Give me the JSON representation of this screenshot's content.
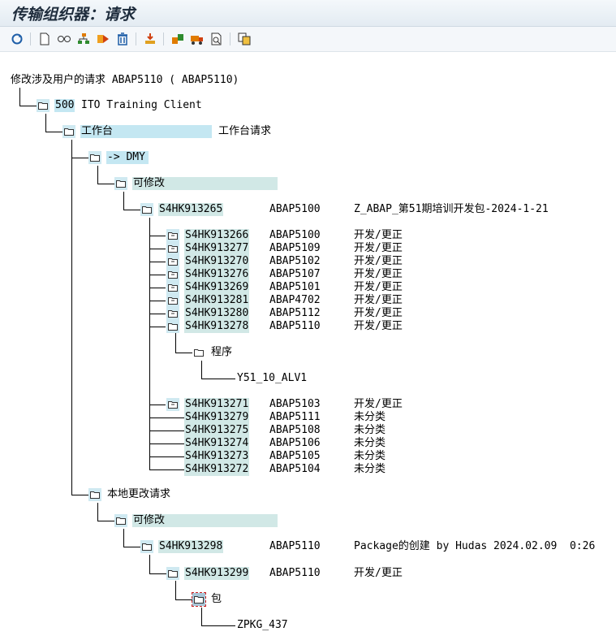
{
  "window": {
    "title": "传输组织器：请求"
  },
  "toolbar": {
    "icons": [
      "refresh-icon",
      "new-document-icon",
      "display-change-icon",
      "hierarchy-icon",
      "release-icon",
      "delete-icon",
      "import-icon",
      "object-list-icon",
      "transport-truck-icon",
      "search-icon",
      "copy-icon"
    ]
  },
  "colors": {
    "folder_highlight": "#cfe9f1",
    "band_highlight": "#d1e8e6",
    "selected_cyan": "#c4e7f2"
  },
  "tree": {
    "root": "修改涉及用户的请求 ABAP5110 ( ABAP5110)",
    "client_number": "500",
    "client_name": "ITO Training Client",
    "workbench": {
      "label": "工作台",
      "desc": "工作台请求"
    },
    "dmy": "-> DMY",
    "modifiable": "可修改",
    "main_request": {
      "id": "S4HK913265",
      "user": "ABAP5100",
      "desc": "Z_ABAP_第51期培训开发包-2024-1-21"
    },
    "tasks": [
      {
        "id": "S4HK913266",
        "user": "ABAP5100",
        "type": "开发/更正"
      },
      {
        "id": "S4HK913277",
        "user": "ABAP5109",
        "type": "开发/更正"
      },
      {
        "id": "S4HK913270",
        "user": "ABAP5102",
        "type": "开发/更正"
      },
      {
        "id": "S4HK913276",
        "user": "ABAP5107",
        "type": "开发/更正"
      },
      {
        "id": "S4HK913269",
        "user": "ABAP5101",
        "type": "开发/更正"
      },
      {
        "id": "S4HK913281",
        "user": "ABAP4702",
        "type": "开发/更正"
      },
      {
        "id": "S4HK913280",
        "user": "ABAP5112",
        "type": "开发/更正"
      },
      {
        "id": "S4HK913278",
        "user": "ABAP5110",
        "type": "开发/更正"
      }
    ],
    "program_folder": "程序",
    "program_object": "Y51_10_ALV1",
    "tasks2": [
      {
        "id": "S4HK913271",
        "user": "ABAP5103",
        "type": "开发/更正"
      },
      {
        "id": "S4HK913279",
        "user": "ABAP5111",
        "type": "未分类"
      },
      {
        "id": "S4HK913275",
        "user": "ABAP5108",
        "type": "未分类"
      },
      {
        "id": "S4HK913274",
        "user": "ABAP5106",
        "type": "未分类"
      },
      {
        "id": "S4HK913273",
        "user": "ABAP5105",
        "type": "未分类"
      },
      {
        "id": "S4HK913272",
        "user": "ABAP5104",
        "type": "未分类"
      }
    ],
    "local": {
      "label": "本地更改请求"
    },
    "modifiable2": "可修改",
    "local_request": {
      "id": "S4HK913298",
      "user": "ABAP5110",
      "desc": "Package的创建 by Hudas 2024.02.09  0:26"
    },
    "local_task": {
      "id": "S4HK913299",
      "user": "ABAP5110",
      "type": "开发/更正"
    },
    "package_folder": "包",
    "package_object": "ZPKG_437"
  }
}
